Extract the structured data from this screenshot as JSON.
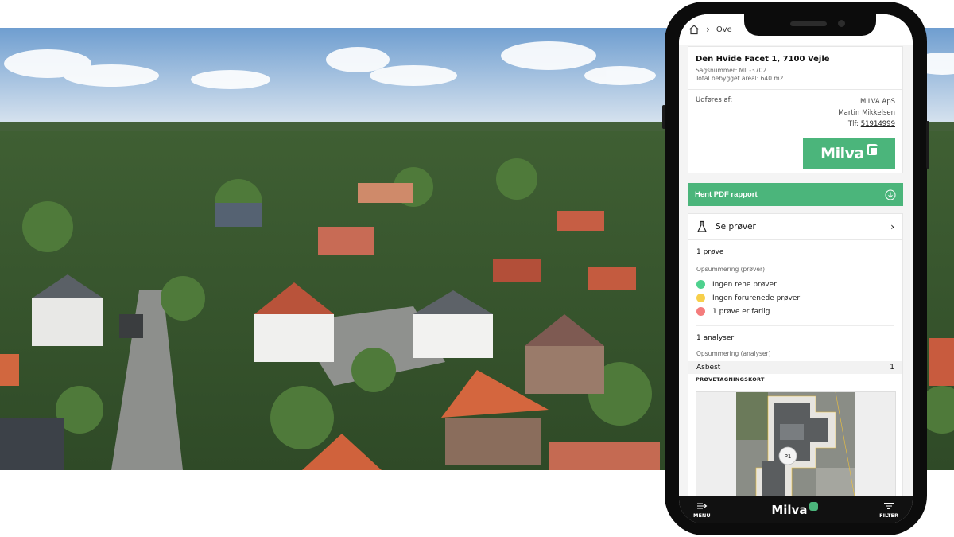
{
  "breadcrumb": {
    "current": "Ove"
  },
  "case": {
    "address": "Den Hvide Facet 1, 7100 Vejle",
    "case_number": "Sagsnummer: MIL-3702",
    "area": "Total bebygget areal: 640 m2",
    "performed_by_label": "Udføres af:",
    "company": "MILVA ApS",
    "person": "Martin Mikkelsen",
    "phone_label": "Tlf:",
    "phone": "51914999",
    "logo_text": "Milva"
  },
  "pdf_button": {
    "label": "Hent PDF rapport"
  },
  "samples": {
    "header": "Se prøver",
    "count": "1 prøve",
    "summary_label": "Opsummering (prøver)",
    "legend": [
      {
        "label": "Ingen rene prøver",
        "color": "#4ed18e"
      },
      {
        "label": "Ingen forurenede prøver",
        "color": "#f7cf4a"
      },
      {
        "label": "1 prøve er farlig",
        "color": "#f47c7c"
      }
    ],
    "analyses_count": "1 analyser",
    "analyses_summary_label": "Opsummering (analyser)",
    "analysis_name": "Asbest",
    "analysis_value": "1",
    "map_label": "PRØVETAGNINGSKORT",
    "marker": "P1"
  },
  "footer": {
    "menu": "MENU",
    "logo": "Milva",
    "filter": "FILTER"
  },
  "colors": {
    "accent": "#4bb57b",
    "footer": "#111111"
  }
}
